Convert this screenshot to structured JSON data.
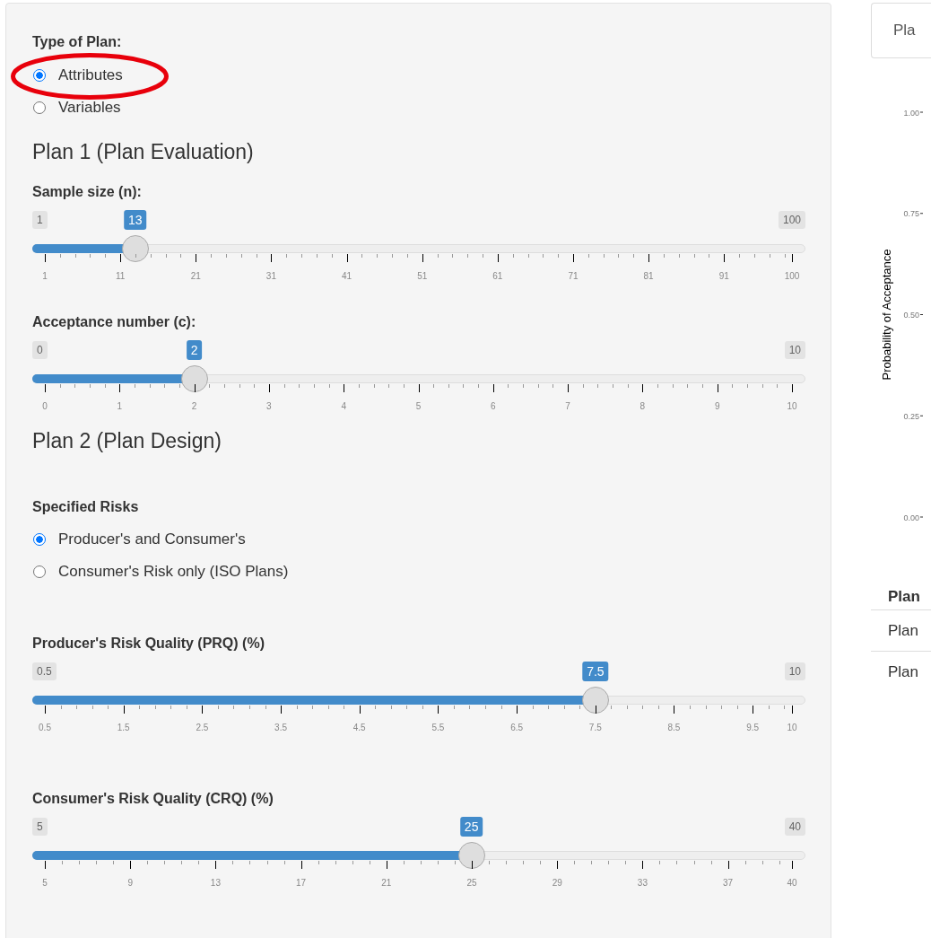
{
  "sidebar": {
    "type_of_plan": {
      "label": "Type of Plan:",
      "options": [
        {
          "label": "Attributes",
          "selected": true,
          "circled": true
        },
        {
          "label": "Variables",
          "selected": false,
          "circled": false
        }
      ]
    },
    "plan1": {
      "heading": "Plan 1 (Plan Evaluation)",
      "sliders": [
        {
          "label": "Sample size (n):",
          "min": "1",
          "max": "100",
          "value": "13",
          "level": 0.121,
          "ticks": [
            "1",
            "11",
            "21",
            "31",
            "41",
            "51",
            "61",
            "71",
            "81",
            "91",
            "100"
          ]
        },
        {
          "label": "Acceptance number (c):",
          "min": "0",
          "max": "10",
          "value": "2",
          "level": 0.2,
          "ticks": [
            "0",
            "1",
            "2",
            "3",
            "4",
            "5",
            "6",
            "7",
            "8",
            "9",
            "10"
          ]
        }
      ]
    },
    "plan2": {
      "heading": "Plan 2 (Plan Design)",
      "specified_risks": {
        "label": "Specified Risks",
        "options": [
          {
            "label": "Producer's and Consumer's",
            "selected": true,
            "circled": false
          },
          {
            "label": "Consumer's Risk only (ISO Plans)",
            "selected": false,
            "circled": false
          }
        ]
      },
      "sliders": [
        {
          "label": "Producer's Risk Quality (PRQ) (%)",
          "min": "0.5",
          "max": "10",
          "value": "7.5",
          "level": 0.737,
          "ticks": [
            "0.5",
            "1.5",
            "2.5",
            "3.5",
            "4.5",
            "5.5",
            "6.5",
            "7.5",
            "8.5",
            "9.5",
            "10"
          ]
        },
        {
          "label": "Consumer's Risk Quality (CRQ) (%)",
          "min": "5",
          "max": "40",
          "value": "25",
          "level": 0.571,
          "ticks": [
            "5",
            "9",
            "13",
            "17",
            "21",
            "25",
            "29",
            "33",
            "37",
            "40"
          ]
        }
      ]
    }
  },
  "main": {
    "tabs": [
      {
        "label": "Pla",
        "selected": true
      }
    ],
    "plot": {
      "y_axis_title": "Probability of Acceptance",
      "y_ticks": [
        "1.00",
        "0.75",
        "0.50",
        "0.25",
        "0.00"
      ]
    },
    "table": {
      "columns": [
        "Plan"
      ],
      "rows": [
        [
          "Plan"
        ],
        [
          "Plan"
        ]
      ]
    }
  }
}
